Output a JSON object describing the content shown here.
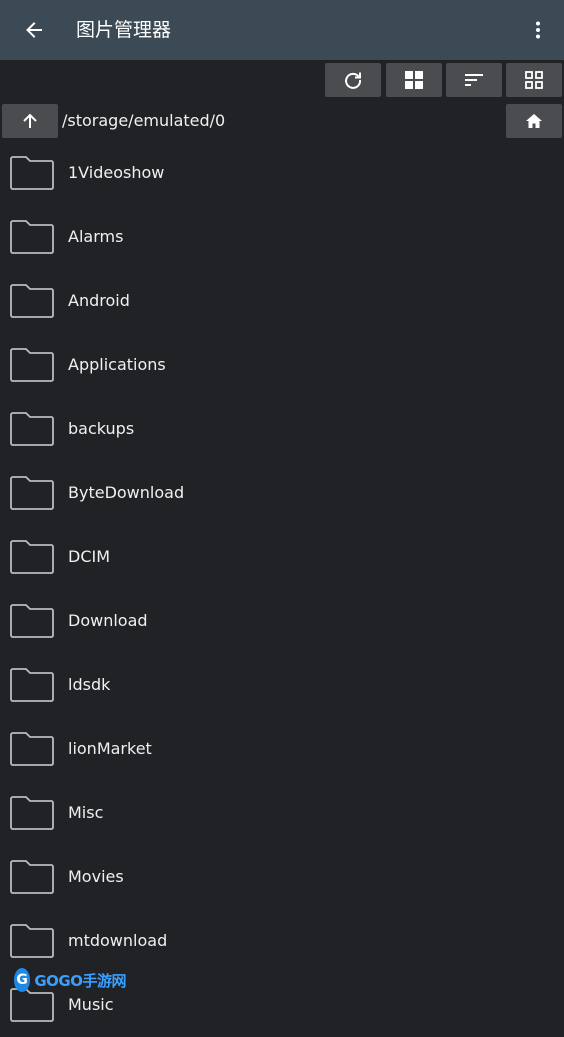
{
  "appbar": {
    "title": "图片管理器",
    "back_icon": "arrow-left-icon",
    "more_icon": "more-vert-icon"
  },
  "toolbar": {
    "buttons": [
      {
        "icon": "refresh-icon"
      },
      {
        "icon": "grid-large-icon"
      },
      {
        "icon": "sort-icon"
      },
      {
        "icon": "grid-small-icon"
      }
    ]
  },
  "navigation": {
    "up_icon": "arrow-up-icon",
    "path": "/storage/emulated/0",
    "home_icon": "home-icon"
  },
  "files": [
    {
      "name": "1Videoshow"
    },
    {
      "name": "Alarms"
    },
    {
      "name": "Android"
    },
    {
      "name": "Applications"
    },
    {
      "name": "backups"
    },
    {
      "name": "ByteDownload"
    },
    {
      "name": "DCIM"
    },
    {
      "name": "Download"
    },
    {
      "name": "ldsdk"
    },
    {
      "name": "lionMarket"
    },
    {
      "name": "Misc"
    },
    {
      "name": "Movies"
    },
    {
      "name": "mtdownload"
    },
    {
      "name": "Music"
    }
  ],
  "watermark": {
    "logo_letter": "G",
    "text": "GOGO手游网"
  },
  "colors": {
    "appbar": "#3b4a54",
    "background": "#212225",
    "button": "#4a4c50",
    "folder_stroke": "#b9bbbe",
    "watermark": "#1e88e5"
  }
}
